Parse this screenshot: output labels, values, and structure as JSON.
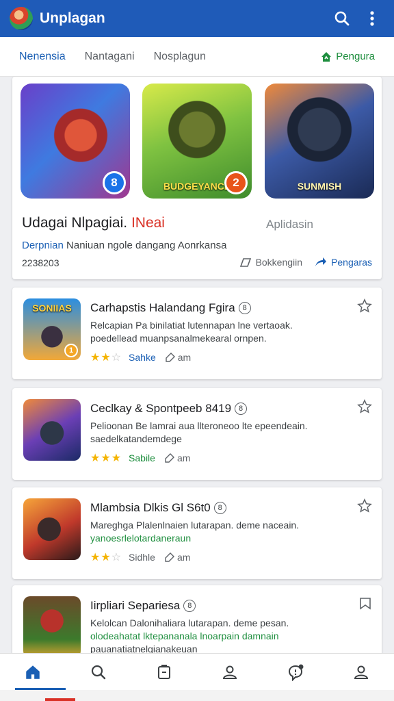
{
  "appbar": {
    "title": "Unplagan",
    "icons": [
      "search-icon",
      "more-vert-icon"
    ]
  },
  "tabs": {
    "items": [
      {
        "label": "Nenensia",
        "active": true
      },
      {
        "label": "Nantagani",
        "active": false
      },
      {
        "label": "Nosplagun",
        "active": false
      }
    ],
    "right_label": "Pengura",
    "accent": "#1a5fb4"
  },
  "featured": {
    "tiles": [
      {
        "caption": "",
        "badge": "8"
      },
      {
        "caption": "BUDGEYANCE",
        "badge": "2"
      },
      {
        "caption": "SUNMISH",
        "badge": ""
      }
    ],
    "title_main": "Udagai Nlpagiai.",
    "title_red": "INeai",
    "aplidasin": "Aplidasin",
    "desc_blue": "Derpnian",
    "desc_rest": "Naniuan ngole dangang Aonrkansa",
    "number": "2238203",
    "bookmark_label": "Bokkengiin",
    "share_label": "Pengaras"
  },
  "cards": [
    {
      "thumb_label": "SONIIAS",
      "thumb_badge": "1",
      "title": "Carhapstis Halandang Fgira",
      "title_badge": "8",
      "desc1": "Relcapian Pa binilatiat lutennapan lne vertaoak.",
      "desc2": "poedellead muanpsanalmekearal ornpen.",
      "rating": 2.5,
      "tag": "Sahke",
      "tag_color": "blue",
      "am": "am"
    },
    {
      "thumb_label": "",
      "thumb_badge": "",
      "title": "Ceclkay & Spontpeeb",
      "title_suffix": "8419",
      "title_badge": "8",
      "desc1": "Pelioonan Be lamrai aua llteroneoo lte epeendeain.",
      "desc2": "saedelkatandemdege",
      "rating": 3,
      "tag": "Sabile",
      "tag_color": "green",
      "am": "am"
    },
    {
      "thumb_label": "",
      "thumb_badge": "",
      "title": "Mlambsia Dlkis",
      "title_suffix": "Gl S6t0",
      "title_badge": "8",
      "desc1": "Mareghga Plalenlnaien lutarapan. deme naceain.",
      "desc2": "yanoesrlelotardaneraun",
      "rating": 2,
      "tag": "Sidhle",
      "tag_color": "grey",
      "am": "am"
    },
    {
      "thumb_label": "",
      "thumb_badge": "",
      "title": "Iirpliari Separiesa",
      "title_badge": "8",
      "desc1": "Kelolcan Dalonihaliara lutarapan. deme pesan.",
      "desc2": "olodeahatat lktepananala lnoarpain damnain",
      "desc3": "pauanatiatnelgianakeuan",
      "rating": 0,
      "tag": "",
      "am": ""
    }
  ],
  "bottom_nav": [
    "home-icon",
    "search-icon",
    "library-icon",
    "profile-icon",
    "notification-icon",
    "account-icon"
  ]
}
